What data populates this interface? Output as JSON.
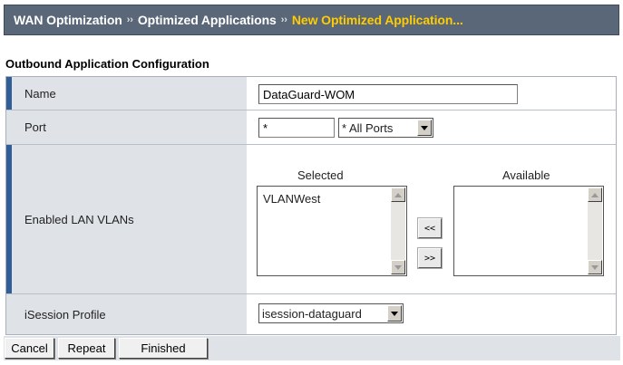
{
  "breadcrumb": {
    "items": [
      "WAN Optimization",
      "Optimized Applications",
      "New Optimized Application..."
    ],
    "separator": "››"
  },
  "section": {
    "title": "Outbound Application Configuration"
  },
  "form": {
    "name": {
      "label": "Name",
      "value": "DataGuard-WOM"
    },
    "port": {
      "label": "Port",
      "value": "*",
      "select_value": "* All Ports"
    },
    "vlans": {
      "label": "Enabled LAN VLANs",
      "selected_header": "Selected",
      "available_header": "Available",
      "selected_items": [
        "VLANWest"
      ],
      "available_items": [],
      "move_left_label": "<<",
      "move_right_label": ">>"
    },
    "isession": {
      "label": "iSession Profile",
      "select_value": "isession-dataguard"
    }
  },
  "actions": {
    "cancel": "Cancel",
    "repeat": "Repeat",
    "finished": "Finished"
  },
  "colors": {
    "header_bg": "#5a6778",
    "current_crumb": "#ffcc00",
    "label_bg": "#dfe3e8",
    "required_marker": "#2f5f96"
  }
}
